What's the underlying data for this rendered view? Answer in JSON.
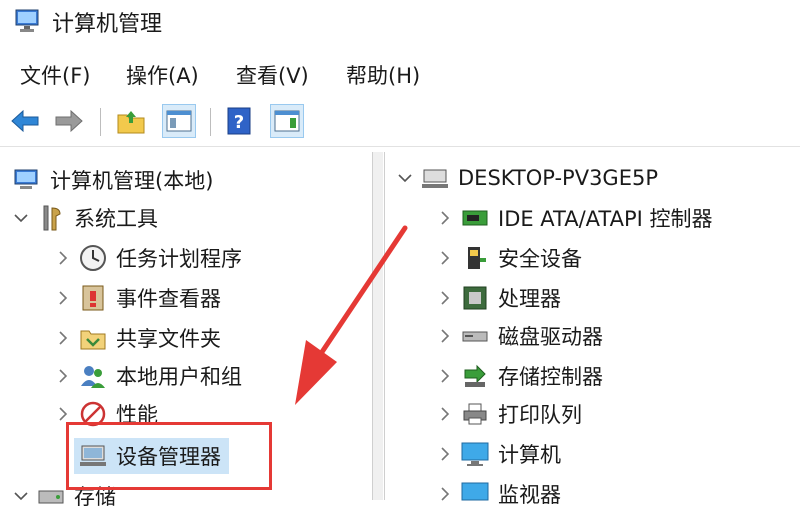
{
  "window": {
    "title": "计算机管理"
  },
  "menu": {
    "file": "文件(F)",
    "action": "操作(A)",
    "view": "查看(V)",
    "help": "帮助(H)"
  },
  "tree": {
    "root": "计算机管理(本地)",
    "system_tools": "系统工具",
    "task_scheduler": "任务计划程序",
    "event_viewer": "事件查看器",
    "shared_folders": "共享文件夹",
    "local_users": "本地用户和组",
    "performance": "性能",
    "device_manager": "设备管理器",
    "storage": "存储"
  },
  "devices": {
    "computer_name": "DESKTOP-PV3GE5P",
    "items": [
      "IDE ATA/ATAPI 控制器",
      "安全设备",
      "处理器",
      "磁盘驱动器",
      "存储控制器",
      "打印队列",
      "计算机",
      "监视器"
    ]
  },
  "colors": {
    "highlight": "#e53935",
    "arrow": "#e53935",
    "toolbar_pressed": "#d9ebf9"
  }
}
